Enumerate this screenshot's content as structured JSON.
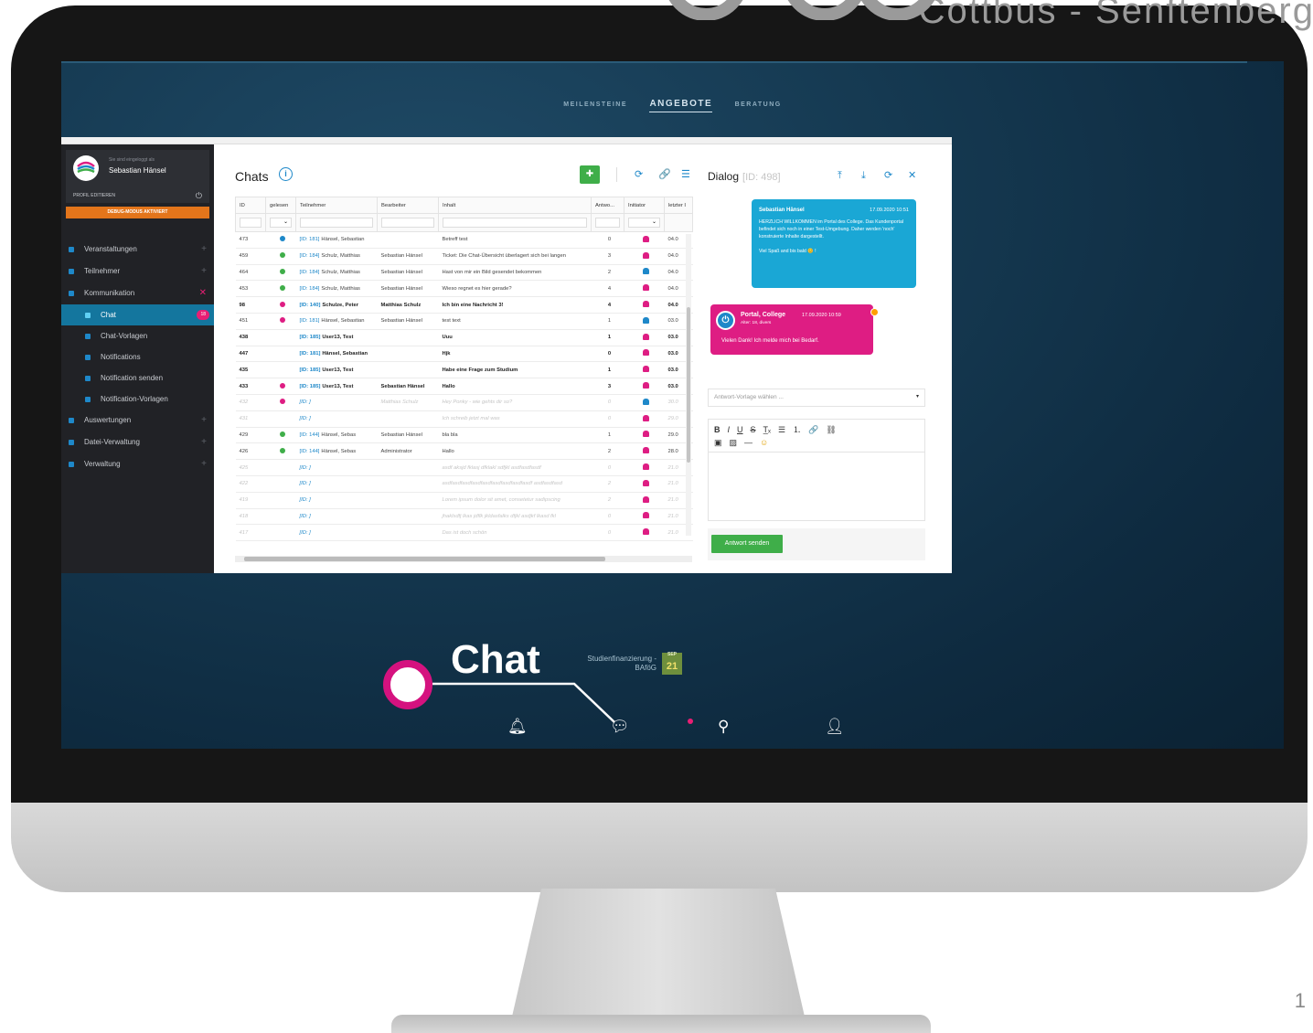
{
  "brand": "Cottbus - Senftenberg",
  "slide_number": "1",
  "nav": {
    "items": [
      "MEILENSTEINE",
      "ANGEBOTE",
      "BERATUNG"
    ],
    "active": "ANGEBOTE"
  },
  "sidebar": {
    "logged_in_as": "Sie sind eingeloggt als",
    "user_name": "Sebastian Hänsel",
    "edit_profile": "PROFIL EDITIEREN",
    "debug": "DEBUG-MODUS AKTIVIERT",
    "items": [
      {
        "label": "Veranstaltungen",
        "icon": "calendar-icon"
      },
      {
        "label": "Teilnehmer",
        "icon": "users-icon"
      },
      {
        "label": "Kommunikation",
        "icon": "chat-icon"
      },
      {
        "label": "Chat",
        "icon": "chat-icon",
        "badge": "18"
      },
      {
        "label": "Chat-Vorlagen",
        "icon": "file-icon"
      },
      {
        "label": "Notifications",
        "icon": "bell-icon"
      },
      {
        "label": "Notification senden",
        "icon": "send-icon"
      },
      {
        "label": "Notification-Vorlagen",
        "icon": "file-icon"
      },
      {
        "label": "Auswertungen",
        "icon": "chart-icon"
      },
      {
        "label": "Datei-Verwaltung",
        "icon": "folder-icon"
      },
      {
        "label": "Verwaltung",
        "icon": "gear-icon"
      }
    ]
  },
  "chats": {
    "title": "Chats",
    "columns": [
      "ID",
      "gelesen",
      "Teilnehmer",
      "Bearbeiter",
      "Inhalt",
      "Antwo...",
      "Initiator",
      "letzter I"
    ],
    "rows": [
      {
        "id": "473",
        "dot": "#1e88c9",
        "pid": "[ID: 181]",
        "participant": "Hänsel, Sebastian",
        "editor": "",
        "content": "Betreff test",
        "answers": "0",
        "initiator": "#de1d83",
        "last": "04.0",
        "style": ""
      },
      {
        "id": "459",
        "dot": "#3fae49",
        "pid": "[ID: 184]",
        "participant": "Schulz, Matthias",
        "editor": "Sebastian Hänsel",
        "content": "Ticket: Die Chat-Übersicht überlagert sich bei langen",
        "answers": "3",
        "initiator": "#de1d83",
        "last": "04.0",
        "style": ""
      },
      {
        "id": "464",
        "dot": "#3fae49",
        "pid": "[ID: 184]",
        "participant": "Schulz, Matthias",
        "editor": "Sebastian Hänsel",
        "content": "Hast von mir ein Bild gesendet bekommen",
        "answers": "2",
        "initiator": "#1e88c9",
        "last": "04.0",
        "style": ""
      },
      {
        "id": "453",
        "dot": "#3fae49",
        "pid": "[ID: 184]",
        "participant": "Schulz, Matthias",
        "editor": "Sebastian Hänsel",
        "content": "Wieso regnet es hier gerade?",
        "answers": "4",
        "initiator": "#de1d83",
        "last": "04.0",
        "style": ""
      },
      {
        "id": "98",
        "dot": "#de1d83",
        "pid": "[ID: 140]",
        "participant": "Schulze, Peter",
        "editor": "Matthias Schulz",
        "content": "Ich bin eine Nachricht 3!",
        "answers": "4",
        "initiator": "#de1d83",
        "last": "04.0",
        "style": "unread"
      },
      {
        "id": "451",
        "dot": "#de1d83",
        "pid": "[ID: 181]",
        "participant": "Hänsel, Sebastian",
        "editor": "Sebastian Hänsel",
        "content": "test text",
        "answers": "1",
        "initiator": "#1e88c9",
        "last": "03.0",
        "style": ""
      },
      {
        "id": "438",
        "dot": "",
        "pid": "[ID: 185]",
        "participant": "User13, Test",
        "editor": "",
        "content": "Uuu",
        "answers": "1",
        "initiator": "#de1d83",
        "last": "03.0",
        "style": "unread"
      },
      {
        "id": "447",
        "dot": "",
        "pid": "[ID: 181]",
        "participant": "Hänsel, Sebastian",
        "editor": "",
        "content": "Hjk",
        "answers": "0",
        "initiator": "#de1d83",
        "last": "03.0",
        "style": "unread"
      },
      {
        "id": "435",
        "dot": "",
        "pid": "[ID: 185]",
        "participant": "User13, Test",
        "editor": "",
        "content": "Habe eine Frage zum Studium",
        "answers": "1",
        "initiator": "#de1d83",
        "last": "03.0",
        "style": "unread"
      },
      {
        "id": "433",
        "dot": "#de1d83",
        "pid": "[ID: 185]",
        "participant": "User13, Test",
        "editor": "Sebastian Hänsel",
        "content": "Hallo",
        "answers": "3",
        "initiator": "#de1d83",
        "last": "03.0",
        "style": "unread"
      },
      {
        "id": "432",
        "dot": "#de1d83",
        "pid": "[ID: ]",
        "participant": "",
        "editor": "Matthias Schulz",
        "content": "Hey Ponky - wie gehts dir so?",
        "answers": "0",
        "initiator": "#1e88c9",
        "last": "30.0",
        "style": "dim"
      },
      {
        "id": "431",
        "dot": "",
        "pid": "[ID: ]",
        "participant": "",
        "editor": "",
        "content": "Ich schreib jetzt mal was",
        "answers": "0",
        "initiator": "#de1d83",
        "last": "29.0",
        "style": "dim"
      },
      {
        "id": "429",
        "dot": "#3fae49",
        "pid": "[ID: 144]",
        "participant": "Hänsel, Sebas",
        "editor": "Sebastian Hänsel",
        "content": "bla bla",
        "answers": "1",
        "initiator": "#de1d83",
        "last": "29.0",
        "style": ""
      },
      {
        "id": "426",
        "dot": "#3fae49",
        "pid": "[ID: 144]",
        "participant": "Hänsel, Sebas",
        "editor": "Administrator",
        "content": "Hallo",
        "answers": "2",
        "initiator": "#de1d83",
        "last": "28.0",
        "style": ""
      },
      {
        "id": "425",
        "dot": "",
        "pid": "[ID: ]",
        "participant": "",
        "editor": "",
        "content": "asdf aksjd fklasj dfklakl sdfjkl asdfasdfasdf",
        "answers": "0",
        "initiator": "#de1d83",
        "last": "21.0",
        "style": "dim"
      },
      {
        "id": "422",
        "dot": "",
        "pid": "[ID: ]",
        "participant": "",
        "editor": "",
        "content": "asdfasdfasdfasdfasdfasdfasdfasdfasdf asdfasdfasd",
        "answers": "2",
        "initiator": "#de1d83",
        "last": "21.0",
        "style": "dim"
      },
      {
        "id": "419",
        "dot": "",
        "pid": "[ID: ]",
        "participant": "",
        "editor": "",
        "content": "Lorem ipsum dolor sit amet, consetetur sadipscing",
        "answers": "2",
        "initiator": "#de1d83",
        "last": "21.0",
        "style": "dim"
      },
      {
        "id": "418",
        "dot": "",
        "pid": "[ID: ]",
        "participant": "",
        "editor": "",
        "content": "jhaklsdfj lkas jdflk jkldasfalks dfjkl asdjkf lkasd fkl",
        "answers": "0",
        "initiator": "#de1d83",
        "last": "21.0",
        "style": "dim"
      },
      {
        "id": "417",
        "dot": "",
        "pid": "[ID: ]",
        "participant": "",
        "editor": "",
        "content": "Das ist doch schön",
        "answers": "0",
        "initiator": "#de1d83",
        "last": "21.0",
        "style": "dim"
      }
    ]
  },
  "dialog": {
    "title": "Dialog",
    "id": "[ID: 498]",
    "msg1": {
      "author": "Sebastian Hänsel",
      "time": "17.09.2020 10:51",
      "text": "HERZLICH WILLKOMMEN im Portal des College. Das Kundenportal befindet sich noch in einer Test-Umgebung. Daher werden 'noch' konstruierte Inhalte dargestellt.",
      "text2": "Viel Spaß and bis bald 😊 !"
    },
    "msg2": {
      "author": "Portal, College",
      "time": "17.09.2020 10:59",
      "sub": "Alter: 18, divers",
      "text": "Vielen Dank! Ich melde mich bei Bedarf."
    },
    "template_placeholder": "Antwort-Vorlage wählen ...",
    "send_label": "Antwort senden"
  },
  "callout": "Chat",
  "bafog": {
    "label": "Studienfinanzierung - BAföG",
    "month": "SEP",
    "day": "21"
  },
  "colors": {
    "accent": "#1e88c9",
    "pink": "#de1d83",
    "green": "#3fae49",
    "orange": "#e3751b"
  }
}
